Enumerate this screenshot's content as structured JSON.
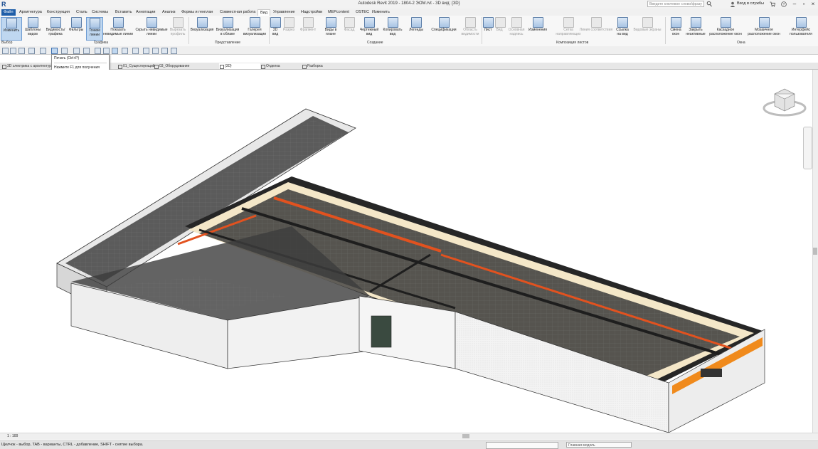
{
  "titlebar": {
    "app_title": "Autodesk Revit 2019 - 1804-2 ЭОМ.rvt - 3D вид: {3D}",
    "search_placeholder": "Введите ключевое слово/фразу",
    "signin_label": "Вход в службы",
    "logo": "R"
  },
  "tabs": [
    "Файл",
    "Архитектура",
    "Конструкция",
    "Сталь",
    "Системы",
    "Вставить",
    "Аннотации",
    "Анализ",
    "Формы и генплан",
    "Совместная работа",
    "Вид",
    "Управление",
    "Надстройки",
    "MEPcontent",
    "OSTEC",
    "Изменить"
  ],
  "ribbon": {
    "buttons": [
      "Изменить",
      "Шаблоны видов",
      "Видимость/ графика",
      "Фильтры",
      "Тонкие линии",
      "Показать невидимые линии",
      "Скрыть невидимые линии",
      "Вырезать профиль",
      "Визуализация",
      "Визуализация в облаке",
      "Галерея визуализации",
      "3D вид",
      "Разрез",
      "Фрагмент",
      "Виды в плане",
      "Фасад",
      "Чертежный вид",
      "Копировать вид",
      "Легенды",
      "Спецификации",
      "Область видимости",
      "Лист",
      "Вид",
      "Основная надпись",
      "Изменения",
      "Сетка направляющих",
      "Линия соответствия",
      "Ссылка на вид",
      "Видовые экраны",
      "Смена окон",
      "Закрыть неактивные",
      "Каскадное расположение окон",
      "Мозаичное расположение окон",
      "Интерфейс пользователя"
    ],
    "panels": [
      "Выбор",
      "Графика",
      "Представление",
      "Создание",
      "Композиция листов",
      "Окна"
    ]
  },
  "tooltip": {
    "title": "Печать (Ctrl+P)",
    "help": "Нажмите F1 для получения дополнительной справки"
  },
  "view_tabs": [
    "3D электрика с архитектурой",
    "",
    "01_Существующий",
    "03_Оборудование",
    "{3D}",
    "Отделка",
    "Разборка"
  ],
  "status": {
    "text": "Щелчок - выбор, TAB - варианты, CTRL - добавление, SHIFT - снятие выбора.",
    "scale": "1 : 100",
    "model": "Главная модель"
  },
  "colors": {
    "file_tab": "#1f5ea8",
    "roof_band": "#e2521f",
    "slab": "#262626",
    "accent_orange": "#f08a1c"
  }
}
